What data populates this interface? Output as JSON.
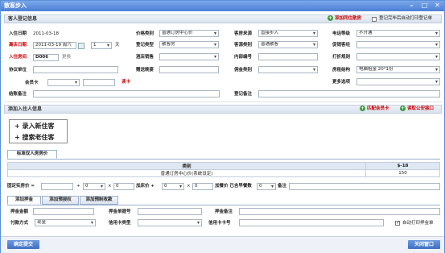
{
  "window": {
    "title": "散客步入"
  },
  "guest_info": {
    "header": "客人登记信息",
    "add_mid_room": "添加同住散房",
    "print_checkin_label": "登记完毕后自动打印登记单",
    "checkin_date_label": "入住日期",
    "checkin_date": "2011-03-18",
    "checkout_date_label": "离店日期",
    "checkout_date": "2011-03-19 周六",
    "days": "1",
    "days_unit": "天",
    "room_label": "入住房间",
    "room_no": "D006",
    "change_label": "更换",
    "agreement_label": "协议单位",
    "member_card_label": "会员卡",
    "read_card": "读卡",
    "checkout_note_label": "结账备注",
    "price_type_label": "价格类别",
    "price_type": "普通订房中心价",
    "checkin_type_label": "登记类型",
    "checkin_type": "散客房",
    "hotel_sales_label": "酒店销售",
    "free_breakfast_label": "赠送晚宴",
    "source_label": "客房来源",
    "source": "直接步入",
    "market_label": "客源类别",
    "market": "普通散客",
    "internal_no_label": "内部编号",
    "deposit_type_label": "佣金类别",
    "checkin_note_label": "登记备注",
    "phone_label": "电话等级",
    "phone": "不开通",
    "sales_manager_label": "促销客经",
    "discount_rule_label": "打折规则",
    "room_structure_label": "房租结构",
    "room_structure": "电脑租金 20*1份",
    "more_label": "更多选项"
  },
  "checkin_guest": {
    "header": "添加入住人信息",
    "match_member": "匹配会员卡",
    "read_police": "读取公安接口",
    "add_new_guest": "+ 录入新住客",
    "search_old_guest": "+ 搜索老住客"
  },
  "price_table": {
    "tab": "标准双人房房价",
    "headers": [
      "类别",
      "$-18"
    ],
    "rows": [
      [
        "普通订房中心价(系统设定)",
        "150"
      ]
    ],
    "fixed_price_label": "固定实房价 =",
    "plus1": "+",
    "v1": "0",
    "x1": "×",
    "v2": "0",
    "bed_price_label": "加床价 +",
    "v3": "0",
    "x2": "×",
    "v4": "0",
    "meal_label": "加餐价 已含早餐数",
    "v5": "0",
    "remark_label": "备注"
  },
  "deposit_tabs": [
    "添加押金",
    "添加预授权",
    "添加预制收款"
  ],
  "deposit": {
    "amount_label": "押金金额",
    "voucher_label": "押金单据号",
    "remark_label": "押金备注",
    "pay_method_label": "付款方式",
    "pay_method": "现金",
    "card_type_label": "信用卡类型",
    "card_no_label": "信用卡卡号",
    "auto_print_label": "自动打印押金单"
  },
  "buttons": {
    "confirm": "确定提交",
    "close": "关闭窗口"
  },
  "colors": {
    "accent": "#4a7fd6",
    "label_red": "#cc0000",
    "add_green": "#3a9a3a"
  }
}
